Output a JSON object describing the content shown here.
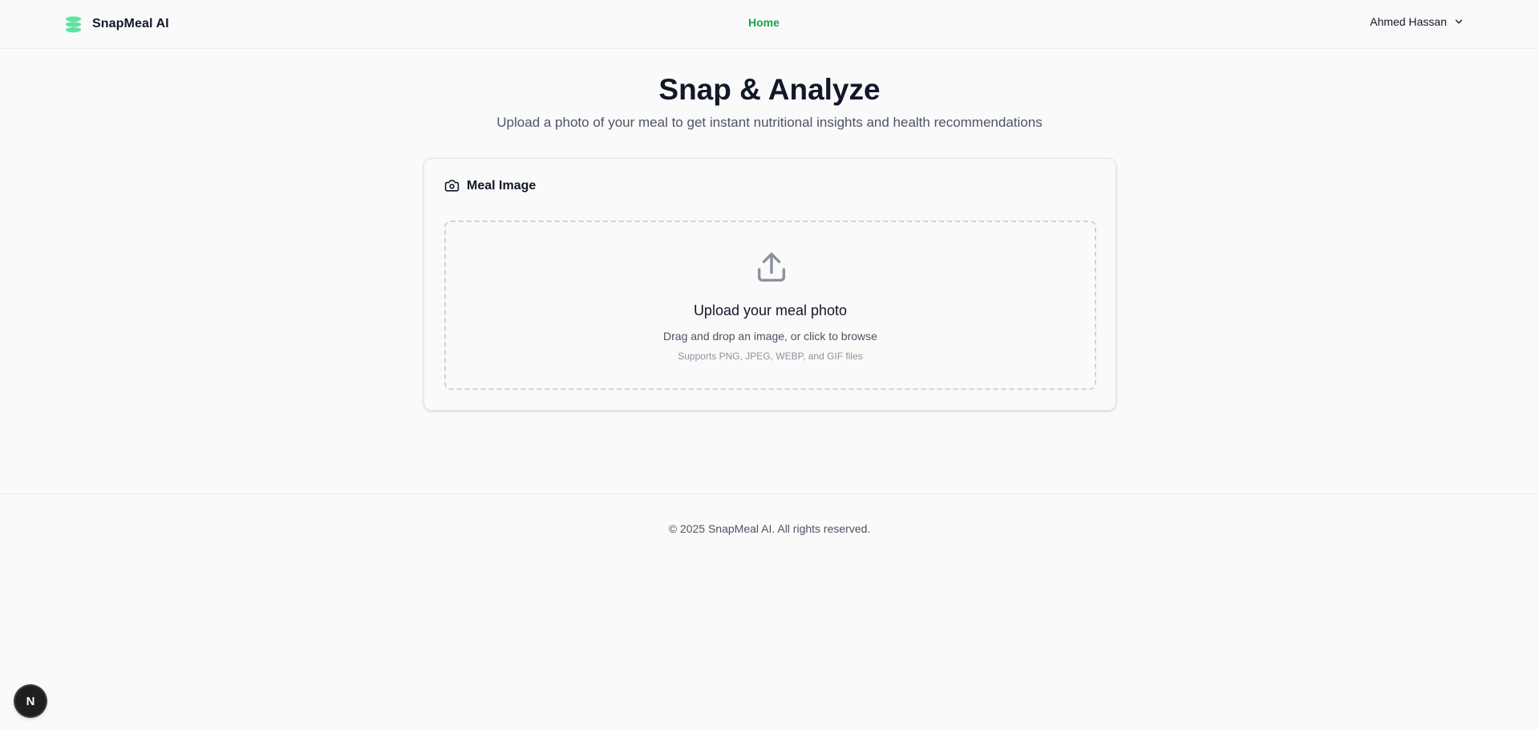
{
  "header": {
    "brand_name": "SnapMeal AI",
    "brand_icon": "stacked-layers-icon",
    "nav": {
      "home_label": "Home"
    },
    "user": {
      "name": "Ahmed Hassan",
      "icon": "chevron-down-icon"
    }
  },
  "hero": {
    "title": "Snap & Analyze",
    "subtitle": "Upload a photo of your meal to get instant nutritional insights and health recommendations"
  },
  "upload_card": {
    "title": "Meal Image",
    "title_icon": "camera-icon",
    "dropzone": {
      "icon": "upload-icon",
      "heading": "Upload your meal photo",
      "instructions": "Drag and drop an image, or click to browse",
      "supported_formats": "Supports PNG, JPEG, WEBP, and GIF files"
    }
  },
  "footer": {
    "copyright": "© 2025 SnapMeal AI. All rights reserved."
  },
  "dev_badge": {
    "label": "N"
  },
  "colors": {
    "accent": "#16a34a",
    "logo": "#5fe3a0",
    "background": "#fafafa",
    "text": "#111827",
    "muted_text": "#4b5563"
  }
}
